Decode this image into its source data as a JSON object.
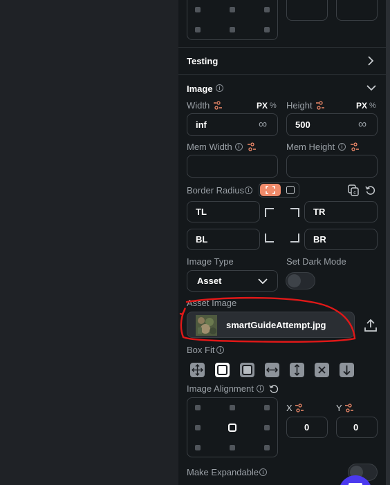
{
  "sections": {
    "testing_title": "Testing",
    "image_title": "Image"
  },
  "image": {
    "width_label": "Width",
    "width_value": "inf",
    "height_label": "Height",
    "height_value": "500",
    "unit_px": "PX",
    "unit_pct": "%",
    "infinity_symbol": "∞",
    "mem_width_label": "Mem Width",
    "mem_height_label": "Mem Height",
    "border_radius_label": "Border Radius",
    "radius_tl": "TL",
    "radius_tr": "TR",
    "radius_bl": "BL",
    "radius_br": "BR",
    "image_type_label": "Image Type",
    "image_type_value": "Asset",
    "dark_mode_label": "Set Dark Mode",
    "asset_image_label": "Asset Image",
    "asset_file_name": "smartGuideAttempt.jpg",
    "box_fit_label": "Box Fit",
    "image_alignment_label": "Image Alignment",
    "x_label": "X",
    "y_label": "Y",
    "x_value": "0",
    "y_value": "0",
    "make_expandable_label": "Make Expandable"
  },
  "colors": {
    "accent": "#f08a6a",
    "annotation": "#e01818",
    "fab": "#4b39ef"
  }
}
